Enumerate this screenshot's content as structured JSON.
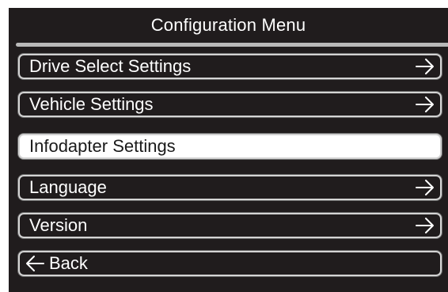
{
  "header": {
    "title": "Configuration Menu"
  },
  "menu": {
    "items": [
      {
        "label": "Drive Select Settings",
        "icon": "arrow-right-icon",
        "selected": false
      },
      {
        "label": "Vehicle Settings",
        "icon": "arrow-right-icon",
        "selected": false
      },
      {
        "label": "Infodapter Settings",
        "icon": "",
        "selected": true
      },
      {
        "label": "Language",
        "icon": "arrow-right-icon",
        "selected": false
      },
      {
        "label": "Version",
        "icon": "arrow-right-icon",
        "selected": false
      }
    ],
    "back": {
      "label": "Back",
      "icon": "arrow-left-icon"
    }
  },
  "colors": {
    "background": "#201c1d",
    "text": "#ffffff",
    "border": "#d4d4d4",
    "selected_background": "#ffffff",
    "selected_text": "#1a1a1a",
    "title_rule": "#b9b9b9"
  }
}
